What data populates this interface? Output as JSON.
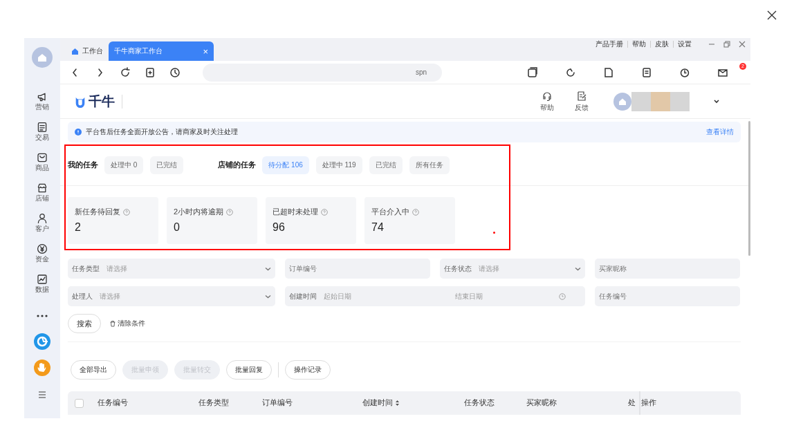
{
  "sidebar": {
    "items": [
      {
        "label": "营销"
      },
      {
        "label": "交易"
      },
      {
        "label": "商品"
      },
      {
        "label": "店铺"
      },
      {
        "label": "客户"
      },
      {
        "label": "资金"
      },
      {
        "label": "数据"
      }
    ]
  },
  "tabs": [
    {
      "label": "工作台",
      "selected": false,
      "closable": false
    },
    {
      "label": "千牛商家工作台",
      "selected": true,
      "closable": true
    }
  ],
  "close_glyph": "×",
  "window_links": [
    "产品手册",
    "帮助",
    "皮肤",
    "设置"
  ],
  "address": {
    "value": "spn"
  },
  "toolbar_badge": "2",
  "header": {
    "logo": "千牛",
    "actions": [
      {
        "label": "帮助"
      },
      {
        "label": "反馈"
      }
    ]
  },
  "notice": {
    "text": "平台售后任务全面开放公告，请商家及时关注处理",
    "link": "查看详情"
  },
  "task_groups": [
    {
      "title": "我的任务",
      "tabs": [
        {
          "label": "处理中 0",
          "selected": false
        },
        {
          "label": "已完结",
          "selected": false
        }
      ]
    },
    {
      "title": "店铺的任务",
      "tabs": [
        {
          "label": "待分配 106",
          "selected": true
        },
        {
          "label": "处理中 119",
          "selected": false
        },
        {
          "label": "已完结",
          "selected": false
        },
        {
          "label": "所有任务",
          "selected": false
        }
      ]
    }
  ],
  "stats": [
    {
      "label": "新任务待回复",
      "value": "2"
    },
    {
      "label": "2小时内将逾期",
      "value": "0"
    },
    {
      "label": "已超时未处理",
      "value": "96"
    },
    {
      "label": "平台介入中",
      "value": "74"
    }
  ],
  "filters": [
    {
      "kind": "select",
      "label": "任务类型",
      "placeholder": "请选择"
    },
    {
      "kind": "input",
      "placeholder": "订单编号"
    },
    {
      "kind": "select",
      "label": "任务状态",
      "placeholder": "请选择"
    },
    {
      "kind": "input",
      "placeholder": "买家昵称"
    },
    {
      "kind": "select",
      "label": "处理人",
      "placeholder": "请选择"
    },
    {
      "kind": "daterange",
      "label": "创建时间",
      "start": "起始日期",
      "end": "结束日期"
    },
    {
      "kind": "input",
      "placeholder": "任务编号"
    }
  ],
  "search_button": "搜索",
  "clear_button": "清除条件",
  "actions": [
    {
      "label": "全部导出",
      "disabled": false
    },
    {
      "label": "批量申领",
      "disabled": true
    },
    {
      "label": "批量转交",
      "disabled": true
    },
    {
      "label": "批量回复",
      "disabled": false
    },
    {
      "label": "操作记录",
      "disabled": false
    }
  ],
  "table": {
    "select_all": {
      "checked": false
    },
    "columns": [
      {
        "label": "任务编号",
        "sortable": false
      },
      {
        "label": "任务类型",
        "sortable": false
      },
      {
        "label": "订单编号",
        "sortable": false
      },
      {
        "label": "创建时间",
        "sortable": true
      },
      {
        "label": "任务状态",
        "sortable": false
      },
      {
        "label": "买家昵称",
        "sortable": false
      },
      {
        "label": "处",
        "sortable": false
      },
      {
        "label": "操作",
        "sortable": false
      }
    ]
  }
}
